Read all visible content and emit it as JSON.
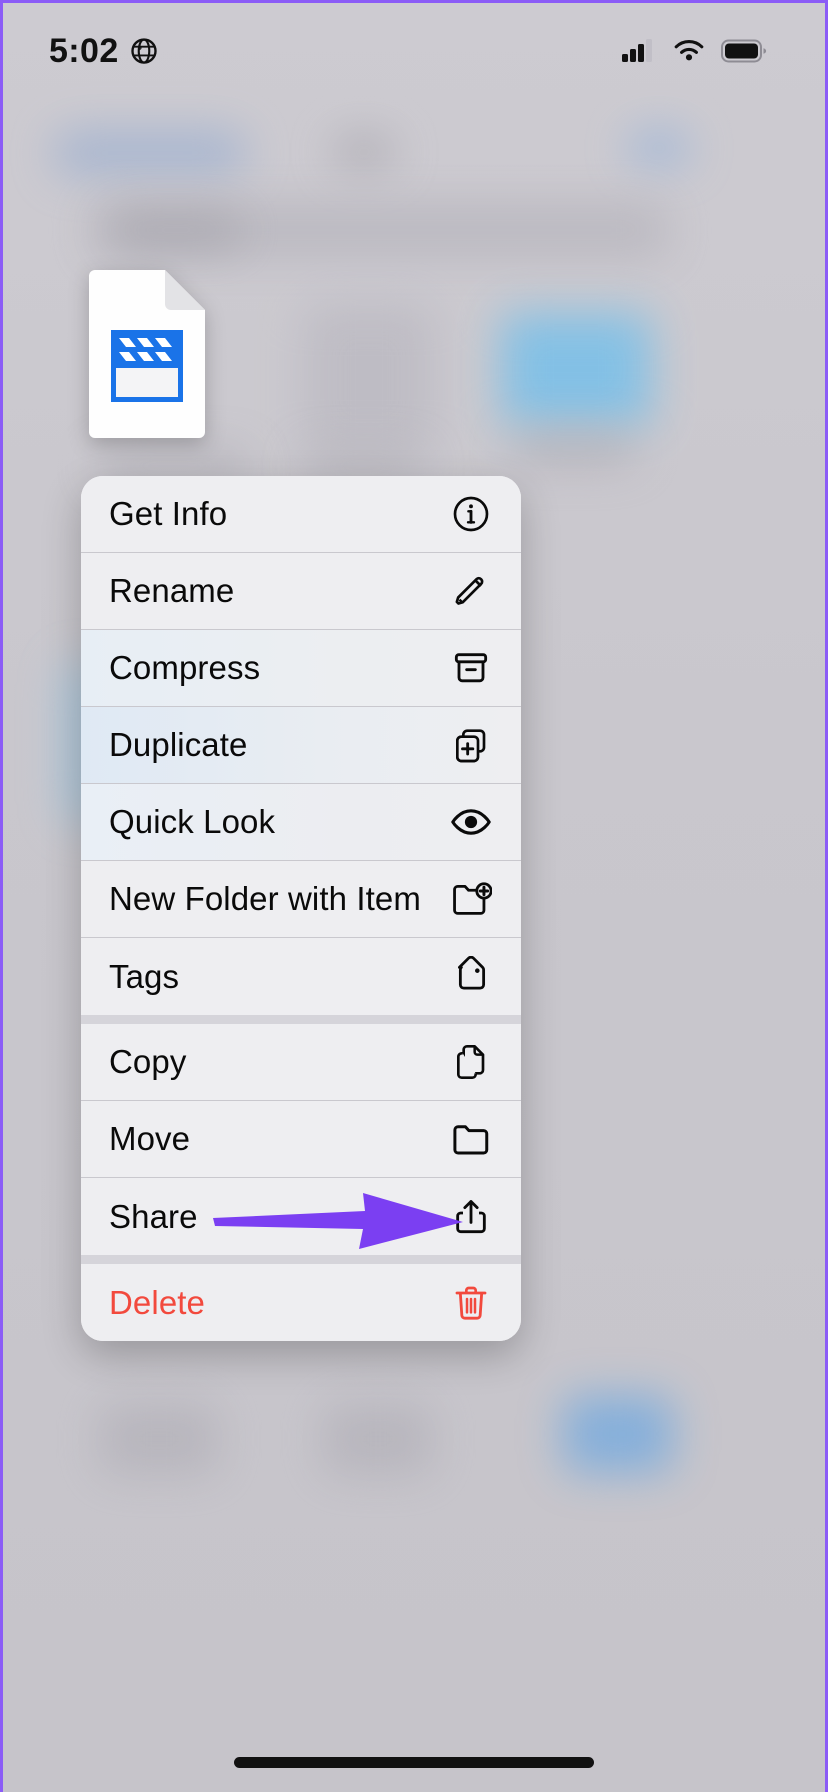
{
  "status_bar": {
    "time": "5:02",
    "location_icon": "globe-icon",
    "cellular_icon": "cellular-signal-icon",
    "wifi_icon": "wifi-icon",
    "battery_icon": "battery-full-icon"
  },
  "file": {
    "thumbnail_icon": "movie-clapperboard-file-icon",
    "accent_color": "#1a73e8"
  },
  "context_menu": {
    "groups": [
      {
        "items": [
          {
            "label": "Get Info",
            "icon": "info-circle-icon",
            "destructive": false,
            "tint": ""
          },
          {
            "label": "Rename",
            "icon": "pencil-icon",
            "destructive": false,
            "tint": ""
          },
          {
            "label": "Compress",
            "icon": "archive-box-icon",
            "destructive": false,
            "tint": "tint-a"
          },
          {
            "label": "Duplicate",
            "icon": "duplicate-icon",
            "destructive": false,
            "tint": "tint-b"
          },
          {
            "label": "Quick Look",
            "icon": "eye-icon",
            "destructive": false,
            "tint": "tint-c"
          },
          {
            "label": "New Folder with Item",
            "icon": "folder-plus-icon",
            "destructive": false,
            "tint": ""
          },
          {
            "label": "Tags",
            "icon": "tag-icon",
            "destructive": false,
            "tint": ""
          }
        ]
      },
      {
        "items": [
          {
            "label": "Copy",
            "icon": "copy-documents-icon",
            "destructive": false,
            "tint": ""
          },
          {
            "label": "Move",
            "icon": "folder-icon",
            "destructive": false,
            "tint": ""
          },
          {
            "label": "Share",
            "icon": "share-icon",
            "destructive": false,
            "tint": ""
          }
        ]
      },
      {
        "items": [
          {
            "label": "Delete",
            "icon": "trash-icon",
            "destructive": true,
            "tint": ""
          }
        ]
      }
    ]
  },
  "annotation": {
    "arrow_color": "#7b3ff2",
    "points_to": "Share"
  },
  "colors": {
    "background": "#c9c7cd",
    "menu_background": "#eeeef1",
    "destructive": "#f2493d",
    "accent": "#1a73e8",
    "annotation": "#7b3ff2",
    "frame_border": "#8b5cf6"
  }
}
